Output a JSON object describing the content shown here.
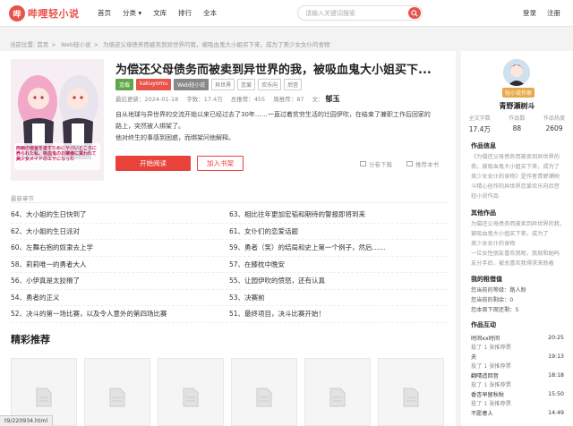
{
  "header": {
    "logo_text": "哔哩轻小说",
    "nav": [
      "首页",
      "分类",
      "文库",
      "排行",
      "全本"
    ],
    "search_placeholder": "请输入关键词搜索",
    "login": "登录",
    "register": "注册"
  },
  "breadcrumb": {
    "prefix": "当前位置:",
    "items": [
      "首页",
      "Web轻小说",
      "为偿还父母债务而被卖到异世界的我，被吸血鬼大小姐买下来，成为了美少女女仆的食物"
    ]
  },
  "book": {
    "title": "为偿还父母债务而被卖到异世界的我，被吸血鬼大小姐买下...",
    "tags": [
      {
        "label": "连载",
        "style": "green"
      },
      {
        "label": "kakuyomu",
        "style": "red"
      },
      {
        "label": "Web轻小说",
        "style": "gray"
      },
      {
        "label": "异世界",
        "style": ""
      },
      {
        "label": "恋爱",
        "style": ""
      },
      {
        "label": "欢乐向",
        "style": ""
      },
      {
        "label": "后宫",
        "style": ""
      }
    ],
    "meta": {
      "updated": "最后更新：2024-01-18",
      "words": "字数：17.4万",
      "recommend": "总推荐：455",
      "weekly": "周推荐：87",
      "author_label": "文：",
      "author": "郁玉"
    },
    "description": [
      "自从地球与异世界的交流开始以来已经过去了30年……一直过着贫穷生活的辻园伊吹，在结束了兼职工作后回家的",
      "路上，突然被人绑架了。",
      "他对终生的事感到困惑，而绑架问他解释。"
    ],
    "read_button": "开始阅读",
    "shelf_button": "加入书架",
    "download_label": "分卷下载",
    "recommend_label": "推荐本书",
    "cover_text": "両親の借金を返すためにヤバいところに売られた私、吸血鬼のお嬢様に買われて美少女メイドのエサになった"
  },
  "latest": {
    "title": "最新章节",
    "chapters": [
      [
        "64、大小姐的生日快到了",
        "63、相比往年更加宏韬和期待的警报即将到来"
      ],
      [
        "62、大小姐的生日派对",
        "61、女仆们的恋爱话题"
      ],
      [
        "60、左舞右抱的奴隶去上学",
        "59、勇者（笑）的结局和史上第一个例子，然后……"
      ],
      [
        "58、莉莉唯一的勇者大人",
        "57、在膝枕中晚安"
      ],
      [
        "56、小伊真是太狡猾了",
        "55、让园伊吹的愤怒，还有认真"
      ],
      [
        "54、勇者的正义",
        "53、决赛前"
      ],
      [
        "52、决斗的第一场比赛，以及令人意外的第四场比赛",
        "51、最终项目，决斗比赛开始！"
      ]
    ]
  },
  "recommend": {
    "title": "精彩推荐",
    "count": 6
  },
  "sidebar": {
    "author_badge": "轻小说作家",
    "author_name": "青野瀬树斗",
    "stats": [
      {
        "label": "全文字数",
        "value": "17.4万"
      },
      {
        "label": "作品数",
        "value": "88"
      },
      {
        "label": "作品热度",
        "value": "2609"
      }
    ],
    "info_title": "作品信息",
    "info_text": [
      "《为偿还父母债务而被卖到异世界的",
      "我，被吸血鬼大小姐买下来，成为了",
      "美少女女仆的食物》是作者青野瀬树",
      "斗精心创作的异世界恋爱欢乐向后宫",
      "轻小说作品"
    ],
    "other_title": "其他作品",
    "other_text": [
      "为偿还父母债务而被卖到异世界的我，",
      "被吸血鬼大小姐买下来，成为了",
      "美少女女仆的食物",
      "一位女性朋友喜欢我呢，我就和她吗",
      "友分手后，被总喜欢我得求来助着"
    ],
    "my_title": "我的租借值",
    "my_items": [
      "您当前的等级：路人粉",
      "您当前的剩余：0",
      "您本周下周还剩：5"
    ],
    "activity_title": "作品互动",
    "activity": [
      {
        "name": "时间xx时间",
        "time": "20:25"
      },
      {
        "note": "投了 1 张推荐票"
      },
      {
        "name": "夫",
        "time": "19:13"
      },
      {
        "note": "投了 1 张推荐票"
      },
      {
        "name": "翻晴造回音",
        "time": "18:18"
      },
      {
        "note": "投了 1 张推荐票"
      },
      {
        "name": "香杏早留秋秋",
        "time": "15:50"
      },
      {
        "note": "投了 1 张推荐票"
      },
      {
        "name": "不愿意人",
        "time": "14:49"
      }
    ]
  },
  "status_bar": {
    "url": "t9/220934.html"
  }
}
